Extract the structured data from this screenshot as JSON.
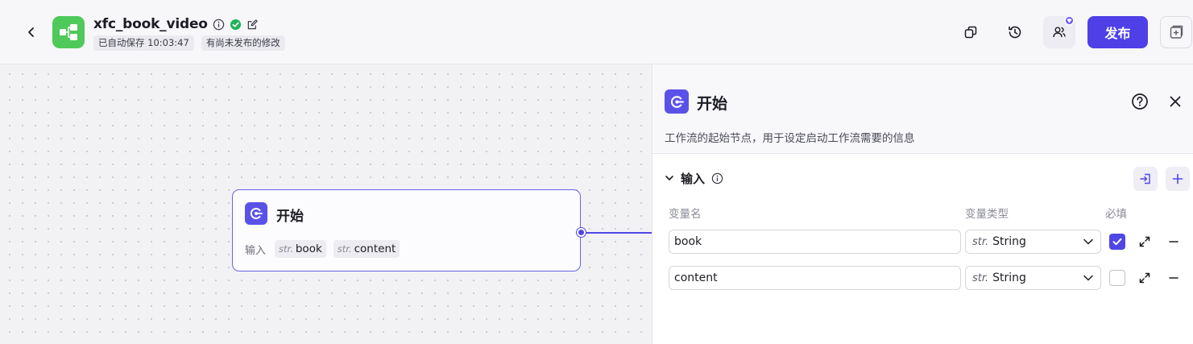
{
  "header": {
    "app_title": "xfc_book_video",
    "autosave_badge": "已自动保存 10:03:47",
    "unpublished_badge": "有尚未发布的修改",
    "publish_label": "发布",
    "icons": [
      "back-icon",
      "workflow-logo-icon",
      "info-icon",
      "status-check-icon",
      "edit-icon",
      "copy-icon",
      "history-icon",
      "collaborators-icon",
      "side-panel-icon"
    ]
  },
  "colors": {
    "accent": "#4e40e6",
    "logo": "#4ec95a",
    "status_ok": "#1fb25a"
  },
  "node": {
    "title": "开始",
    "inputs_label": "输入",
    "inputs": [
      {
        "type": "str.",
        "name": "book"
      },
      {
        "type": "str.",
        "name": "content"
      }
    ]
  },
  "panel": {
    "title": "开始",
    "description": "工作流的起始节点，用于设定启动工作流需要的信息",
    "section_title": "输入",
    "columns": {
      "name": "变量名",
      "type": "变量类型",
      "required": "必填"
    },
    "variables": [
      {
        "name": "book",
        "type_prefix": "str.",
        "type": "String",
        "required": true
      },
      {
        "name": "content",
        "type_prefix": "str.",
        "type": "String",
        "required": false
      }
    ]
  }
}
